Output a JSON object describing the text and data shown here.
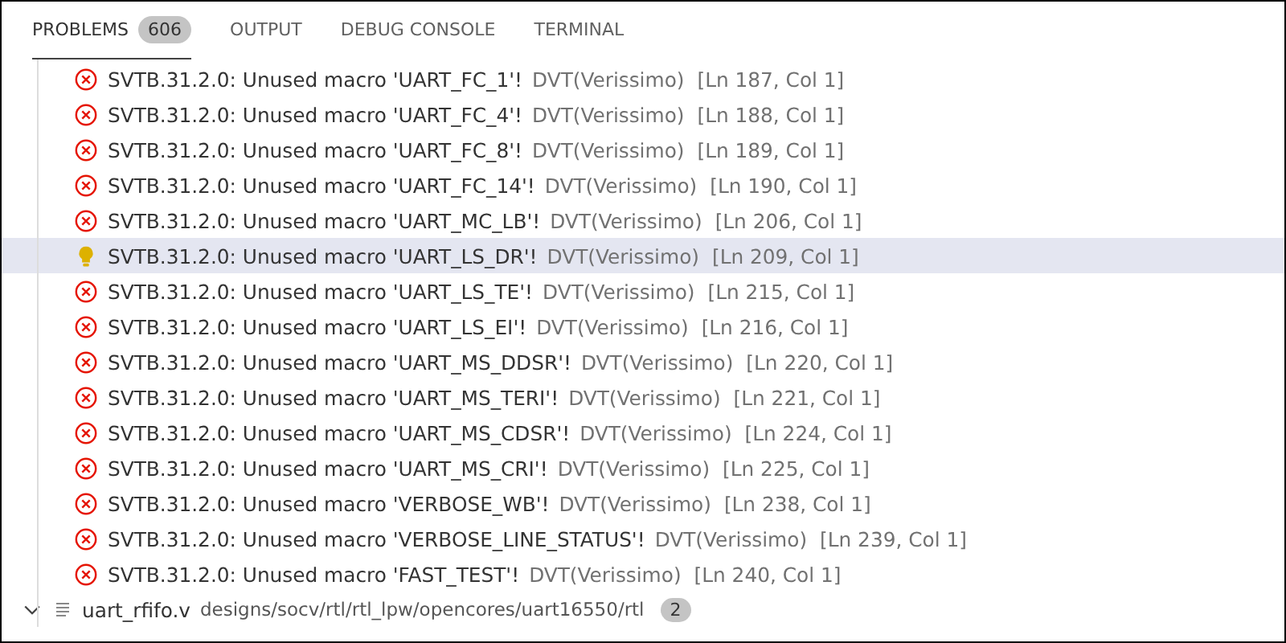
{
  "tabs": [
    {
      "label": "PROBLEMS",
      "badge": "606",
      "selected": true
    },
    {
      "label": "OUTPUT",
      "selected": false
    },
    {
      "label": "DEBUG CONSOLE",
      "selected": false
    },
    {
      "label": "TERMINAL",
      "selected": false
    }
  ],
  "problems": [
    {
      "kind": "error",
      "message": "SVTB.31.2.0: Unused macro 'UART_FC_1'!",
      "source": "DVT(Verissimo)",
      "location": "[Ln 187, Col 1]",
      "selected": false
    },
    {
      "kind": "error",
      "message": "SVTB.31.2.0: Unused macro 'UART_FC_4'!",
      "source": "DVT(Verissimo)",
      "location": "[Ln 188, Col 1]",
      "selected": false
    },
    {
      "kind": "error",
      "message": "SVTB.31.2.0: Unused macro 'UART_FC_8'!",
      "source": "DVT(Verissimo)",
      "location": "[Ln 189, Col 1]",
      "selected": false
    },
    {
      "kind": "error",
      "message": "SVTB.31.2.0: Unused macro 'UART_FC_14'!",
      "source": "DVT(Verissimo)",
      "location": "[Ln 190, Col 1]",
      "selected": false
    },
    {
      "kind": "error",
      "message": "SVTB.31.2.0: Unused macro 'UART_MC_LB'!",
      "source": "DVT(Verissimo)",
      "location": "[Ln 206, Col 1]",
      "selected": false
    },
    {
      "kind": "hint",
      "message": "SVTB.31.2.0: Unused macro 'UART_LS_DR'!",
      "source": "DVT(Verissimo)",
      "location": "[Ln 209, Col 1]",
      "selected": true
    },
    {
      "kind": "error",
      "message": "SVTB.31.2.0: Unused macro 'UART_LS_TE'!",
      "source": "DVT(Verissimo)",
      "location": "[Ln 215, Col 1]",
      "selected": false
    },
    {
      "kind": "error",
      "message": "SVTB.31.2.0: Unused macro 'UART_LS_EI'!",
      "source": "DVT(Verissimo)",
      "location": "[Ln 216, Col 1]",
      "selected": false
    },
    {
      "kind": "error",
      "message": "SVTB.31.2.0: Unused macro 'UART_MS_DDSR'!",
      "source": "DVT(Verissimo)",
      "location": "[Ln 220, Col 1]",
      "selected": false
    },
    {
      "kind": "error",
      "message": "SVTB.31.2.0: Unused macro 'UART_MS_TERI'!",
      "source": "DVT(Verissimo)",
      "location": "[Ln 221, Col 1]",
      "selected": false
    },
    {
      "kind": "error",
      "message": "SVTB.31.2.0: Unused macro 'UART_MS_CDSR'!",
      "source": "DVT(Verissimo)",
      "location": "[Ln 224, Col 1]",
      "selected": false
    },
    {
      "kind": "error",
      "message": "SVTB.31.2.0: Unused macro 'UART_MS_CRI'!",
      "source": "DVT(Verissimo)",
      "location": "[Ln 225, Col 1]",
      "selected": false
    },
    {
      "kind": "error",
      "message": "SVTB.31.2.0: Unused macro 'VERBOSE_WB'!",
      "source": "DVT(Verissimo)",
      "location": "[Ln 238, Col 1]",
      "selected": false
    },
    {
      "kind": "error",
      "message": "SVTB.31.2.0: Unused macro 'VERBOSE_LINE_STATUS'!",
      "source": "DVT(Verissimo)",
      "location": "[Ln 239, Col 1]",
      "selected": false
    },
    {
      "kind": "error",
      "message": "SVTB.31.2.0: Unused macro 'FAST_TEST'!",
      "source": "DVT(Verissimo)",
      "location": "[Ln 240, Col 1]",
      "selected": false
    }
  ],
  "file": {
    "name": "uart_rfifo.v",
    "path": "designs/socv/rtl/rtl_lpw/opencores/uart16550/rtl",
    "count": "2",
    "expanded": true
  }
}
